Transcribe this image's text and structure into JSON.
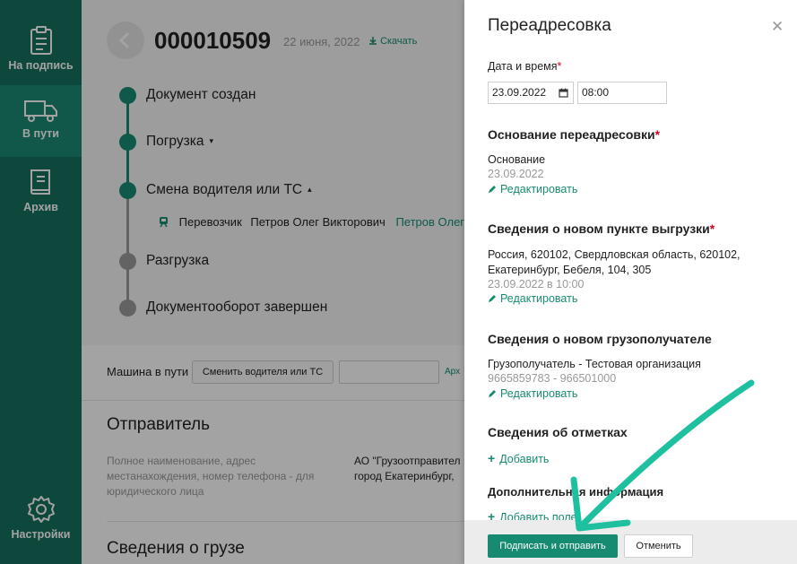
{
  "sidebar": {
    "items": [
      {
        "label": "На подпись",
        "icon": "clipboard-icon"
      },
      {
        "label": "В пути",
        "icon": "truck-icon",
        "active": true
      },
      {
        "label": "Архив",
        "icon": "book-icon"
      },
      {
        "label": "Настройки",
        "icon": "gear-icon"
      }
    ]
  },
  "document": {
    "number": "000010509",
    "date": "22 июня, 2022",
    "download_label": "Скачать"
  },
  "timeline": {
    "steps": [
      {
        "label": "Документ создан",
        "status": "done"
      },
      {
        "label": "Погрузка",
        "status": "done",
        "caret": "▾"
      },
      {
        "label": "Смена водителя или ТС",
        "status": "done",
        "caret": "▴"
      },
      {
        "label": "Разгрузка",
        "status": "pending"
      },
      {
        "label": "Документооборот завершен",
        "status": "pending"
      }
    ],
    "carrier": {
      "label": "Перевозчик",
      "name": "Петров Олег Викторович",
      "link": "Петров Олег В"
    }
  },
  "machine_bar": {
    "label": "Машина в пути",
    "change_button": "Сменить водителя или ТС",
    "archive_link": "Арх"
  },
  "sender": {
    "title": "Отправитель",
    "description": "Полное наименование, адрес местанахождения, номер телефона - для юридического лица",
    "value_line1": "АО \"Грузоотправител",
    "value_line2": "город Екатеринбург, "
  },
  "cargo": {
    "title": "Сведения о грузе"
  },
  "panel": {
    "title": "Переадресовка",
    "datetime": {
      "label": "Дата и время",
      "required_mark": "*",
      "date_value": "23.09.2022",
      "time_value": "08:00"
    },
    "basis": {
      "heading": "Основание переадресовки",
      "required_mark": "*",
      "name": "Основание",
      "date": "23.09.2022",
      "edit_label": "Редактировать"
    },
    "unloading_point": {
      "heading": "Сведения о новом пункте выгрузки",
      "required_mark": "*",
      "address_line1": "Россия, 620102, Свердловская область, 620102,",
      "address_line2": "Екатеринбург, Бебеля, 104, 305",
      "datetime": "23.09.2022 в 10:00",
      "edit_label": "Редактировать"
    },
    "consignee": {
      "heading": "Сведения о новом грузополучателе",
      "name": "Грузополучатель - Тестовая организация",
      "ids": "9665859783 - 966501000",
      "edit_label": "Редактировать"
    },
    "marks": {
      "heading": "Сведения об отметках",
      "add_label": "Добавить"
    },
    "additional": {
      "heading": "Дополнительная информация",
      "add_label": "Добавить поле"
    },
    "footer": {
      "submit_label": "Подписать и отправить",
      "cancel_label": "Отменить"
    }
  },
  "colors": {
    "sidebar_bg": "#16705f",
    "sidebar_active": "#1b8a75",
    "accent": "#178b72",
    "arrow": "#1fc0a0",
    "required": "#d0021b"
  }
}
